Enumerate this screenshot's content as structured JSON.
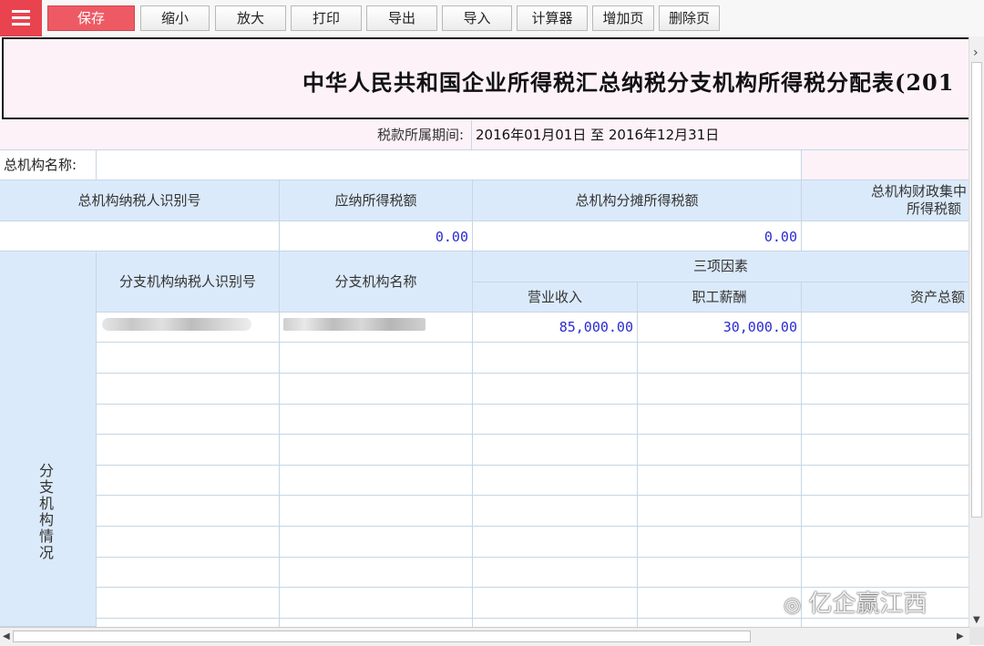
{
  "toolbar": {
    "menu_icon": "hamburger-icon",
    "buttons": [
      "保存",
      "缩小",
      "放大",
      "打印",
      "导出",
      "导入",
      "计算器",
      "增加页",
      "删除页"
    ],
    "save_color": "#ee5a64"
  },
  "form": {
    "title": "中华人民共和国企业所得税汇总纳税分支机构所得税分配表(201",
    "period_label": "税款所属期间:",
    "period_value": "2016年01月01日  至  2016年12月31日",
    "hq_name_label": "总机构名称:",
    "hq_name_value": ""
  },
  "hq_table": {
    "headers": [
      "总机构纳税人识别号",
      "应纳所得税额",
      "总机构分摊所得税额",
      "总机构财政集中",
      "所得税额"
    ],
    "values": [
      "",
      "0.00",
      "0.00",
      ""
    ]
  },
  "branch_table": {
    "section_label": "分支机构情况",
    "col_id": "分支机构纳税人识别号",
    "col_name": "分支机构名称",
    "group_header": "三项因素",
    "sub_headers": [
      "营业收入",
      "职工薪酬",
      "资产总额"
    ],
    "rows": [
      {
        "revenue": "85,000.00",
        "salary": "30,000.00",
        "assets": ""
      }
    ]
  },
  "watermark": "亿企赢江西",
  "watermark_icon": "wechat-icon"
}
